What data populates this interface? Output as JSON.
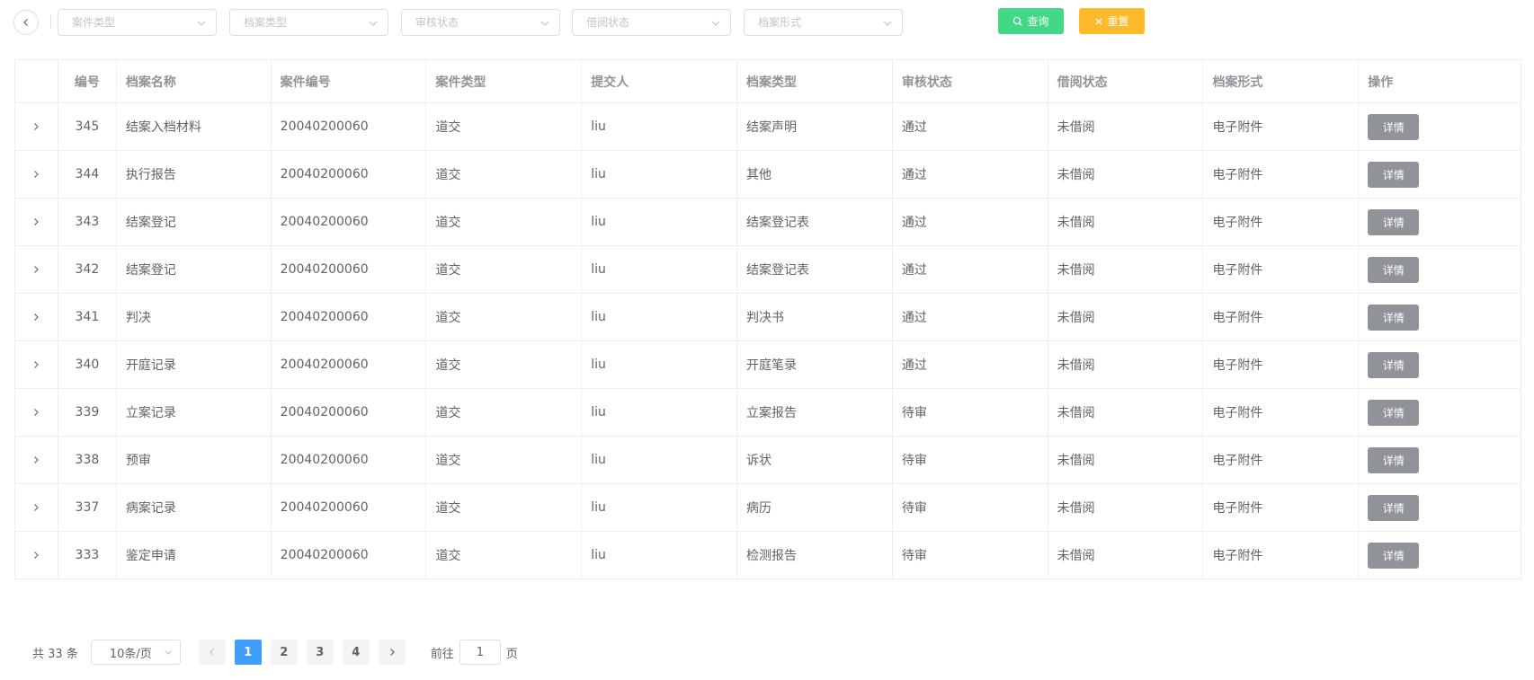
{
  "filters": {
    "back_icon": "chevron-left-icon",
    "selects": [
      {
        "placeholder": "案件类型"
      },
      {
        "placeholder": "档案类型"
      },
      {
        "placeholder": "审核状态"
      },
      {
        "placeholder": "借阅状态"
      },
      {
        "placeholder": "档案形式"
      }
    ],
    "query_label": "查询",
    "reset_label": "重置"
  },
  "table": {
    "columns": [
      "编号",
      "档案名称",
      "案件编号",
      "案件类型",
      "提交人",
      "档案类型",
      "审核状态",
      "借阅状态",
      "档案形式",
      "操作"
    ],
    "action_label": "详情",
    "rows": [
      {
        "id": "345",
        "name": "结案入档材料",
        "case_no": "20040200060",
        "case_type": "道交",
        "submitter": "liu",
        "file_type": "结案声明",
        "review": "通过",
        "borrow": "未借阅",
        "form": "电子附件"
      },
      {
        "id": "344",
        "name": "执行报告",
        "case_no": "20040200060",
        "case_type": "道交",
        "submitter": "liu",
        "file_type": "其他",
        "review": "通过",
        "borrow": "未借阅",
        "form": "电子附件"
      },
      {
        "id": "343",
        "name": "结案登记",
        "case_no": "20040200060",
        "case_type": "道交",
        "submitter": "liu",
        "file_type": "结案登记表",
        "review": "通过",
        "borrow": "未借阅",
        "form": "电子附件"
      },
      {
        "id": "342",
        "name": "结案登记",
        "case_no": "20040200060",
        "case_type": "道交",
        "submitter": "liu",
        "file_type": "结案登记表",
        "review": "通过",
        "borrow": "未借阅",
        "form": "电子附件"
      },
      {
        "id": "341",
        "name": "判决",
        "case_no": "20040200060",
        "case_type": "道交",
        "submitter": "liu",
        "file_type": "判决书",
        "review": "通过",
        "borrow": "未借阅",
        "form": "电子附件"
      },
      {
        "id": "340",
        "name": "开庭记录",
        "case_no": "20040200060",
        "case_type": "道交",
        "submitter": "liu",
        "file_type": "开庭笔录",
        "review": "通过",
        "borrow": "未借阅",
        "form": "电子附件"
      },
      {
        "id": "339",
        "name": "立案记录",
        "case_no": "20040200060",
        "case_type": "道交",
        "submitter": "liu",
        "file_type": "立案报告",
        "review": "待审",
        "borrow": "未借阅",
        "form": "电子附件"
      },
      {
        "id": "338",
        "name": "预审",
        "case_no": "20040200060",
        "case_type": "道交",
        "submitter": "liu",
        "file_type": "诉状",
        "review": "待审",
        "borrow": "未借阅",
        "form": "电子附件"
      },
      {
        "id": "337",
        "name": "病案记录",
        "case_no": "20040200060",
        "case_type": "道交",
        "submitter": "liu",
        "file_type": "病历",
        "review": "待审",
        "borrow": "未借阅",
        "form": "电子附件"
      },
      {
        "id": "333",
        "name": "鉴定申请",
        "case_no": "20040200060",
        "case_type": "道交",
        "submitter": "liu",
        "file_type": "检测报告",
        "review": "待审",
        "borrow": "未借阅",
        "form": "电子附件"
      }
    ]
  },
  "pagination": {
    "total_text": "共 33 条",
    "page_size": "10条/页",
    "pages": [
      "1",
      "2",
      "3",
      "4"
    ],
    "current_page": "1",
    "goto_prefix": "前往",
    "goto_value": "1",
    "goto_suffix": "页"
  },
  "colors": {
    "query": "#42d885",
    "reset": "#ffba2c",
    "active_page": "#409eff",
    "detail_button": "#909399"
  }
}
